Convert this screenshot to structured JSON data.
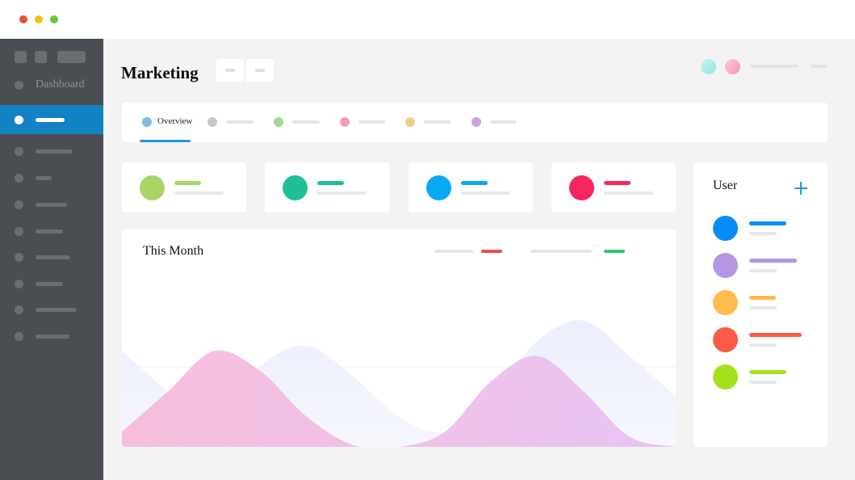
{
  "window": {
    "traffic_lights": [
      {
        "name": "close",
        "color": "#e94e3c"
      },
      {
        "name": "minimize",
        "color": "#f4c20d"
      },
      {
        "name": "maximize",
        "color": "#6cc43c"
      }
    ]
  },
  "sidebar": {
    "items": [
      {
        "label": "Dashboard",
        "active": false
      },
      {
        "label": "",
        "active": true
      },
      {
        "label": "",
        "active": false
      },
      {
        "label": "",
        "active": false
      },
      {
        "label": "",
        "active": false
      },
      {
        "label": "",
        "active": false
      },
      {
        "label": "",
        "active": false
      },
      {
        "label": "",
        "active": false
      },
      {
        "label": "",
        "active": false
      },
      {
        "label": "",
        "active": false
      }
    ]
  },
  "header": {
    "title": "Marketing",
    "avatar_colors": [
      "#a8eee6",
      "#f7a9c4"
    ]
  },
  "tabs": [
    {
      "label": "Overview",
      "color": "#7db9ea",
      "active": true
    },
    {
      "label": "",
      "color": "#c8c8c8",
      "active": false
    },
    {
      "label": "",
      "color": "#9ddc95",
      "active": false
    },
    {
      "label": "",
      "color": "#f3a0b5",
      "active": false
    },
    {
      "label": "",
      "color": "#f5cd8e",
      "active": false
    },
    {
      "label": "",
      "color": "#c8a3dc",
      "active": false
    }
  ],
  "stats": [
    {
      "color": "#aad466"
    },
    {
      "color": "#1ebf98"
    },
    {
      "color": "#08aaf5"
    },
    {
      "color": "#f7265e"
    }
  ],
  "chart": {
    "title": "This Month",
    "legend": [
      {
        "color": "#e4534a"
      },
      {
        "color": "#2dc86f"
      }
    ]
  },
  "chart_data": {
    "type": "area",
    "title": "This Month",
    "series": [
      {
        "color": "#eef0fb",
        "values": [
          0.95,
          0.55,
          0.25,
          0.8,
          1.0,
          0.7,
          0.3,
          0.15,
          0.5,
          1.05,
          1.25,
          0.9,
          0.5
        ]
      },
      {
        "color": "#f8c8e6",
        "values": [
          0.15,
          0.55,
          0.95,
          0.75,
          0.3,
          0.02,
          0.0,
          0.15,
          0.65,
          0.9,
          0.55,
          0.1,
          0.0
        ]
      }
    ]
  },
  "users": {
    "title": "User",
    "list": [
      {
        "color": "#0a8cf5"
      },
      {
        "color": "#b496e4"
      },
      {
        "color": "#fdbc4b"
      },
      {
        "color": "#fa5a4a"
      },
      {
        "color": "#a5e11a"
      }
    ]
  }
}
